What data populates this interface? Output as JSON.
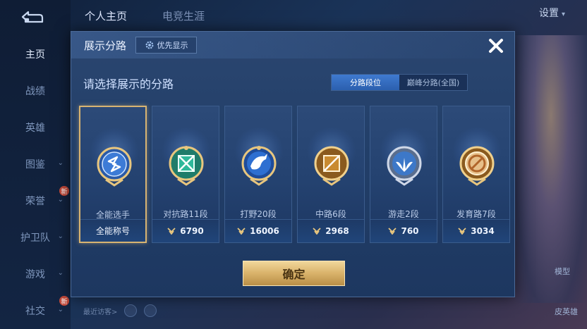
{
  "nav": {
    "items": [
      {
        "label": "主页",
        "active": true
      },
      {
        "label": "战绩"
      },
      {
        "label": "英雄"
      },
      {
        "label": "图鉴",
        "chevron": true
      },
      {
        "label": "荣誉",
        "chevron": true,
        "badge": "新"
      },
      {
        "label": "护卫队",
        "chevron": true
      },
      {
        "label": "游戏",
        "chevron": true
      },
      {
        "label": "社交",
        "chevron": true,
        "badge": "新"
      }
    ]
  },
  "top_tabs": [
    "个人主页",
    "电竞生涯"
  ],
  "settings_label": "设置",
  "side_buttons": [
    "模型",
    "皮英雄"
  ],
  "visitor_label": "最近访客>",
  "modal": {
    "title": "展示分路",
    "priority_label": "优先显示",
    "subtitle": "请选择展示的分路",
    "segments": [
      "分路段位",
      "巅峰分路(全国)"
    ],
    "active_segment": 0,
    "cards": [
      {
        "name": "全能选手",
        "footer": "全能称号",
        "selected": true,
        "icon": "all-round-emblem-icon"
      },
      {
        "name": "对抗路11段",
        "value": "6790",
        "icon": "clash-lane-emblem-icon"
      },
      {
        "name": "打野20段",
        "value": "16006",
        "icon": "jungle-emblem-icon"
      },
      {
        "name": "中路6段",
        "value": "2968",
        "icon": "mid-lane-emblem-icon"
      },
      {
        "name": "游走2段",
        "value": "760",
        "icon": "roam-emblem-icon"
      },
      {
        "name": "发育路7段",
        "value": "3034",
        "icon": "farm-lane-emblem-icon"
      }
    ],
    "confirm_label": "确定"
  },
  "colors": {
    "gold": "#d8b472",
    "segment_active": "#3f7ad0",
    "modal_bg": "#23406a"
  }
}
